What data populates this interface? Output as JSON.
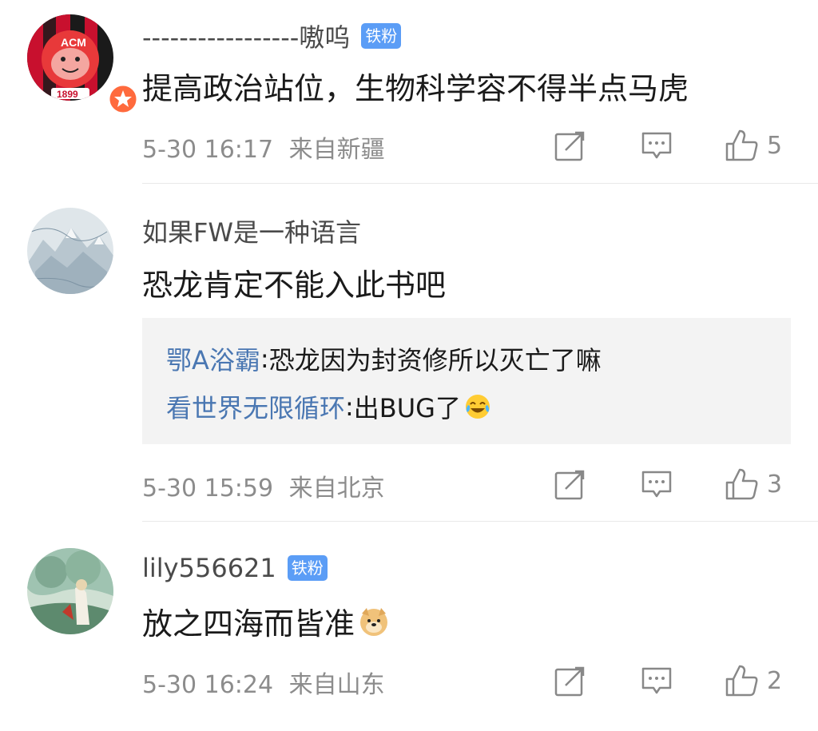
{
  "comments": [
    {
      "username": "-----------------嗷呜",
      "badge": "铁粉",
      "text": "提高政治站位，生物科学容不得半点马虎",
      "time": "5-30 16:17",
      "location": "来自新疆",
      "likes": "5",
      "avatar_icon": "ac-milan-logo-avatar"
    },
    {
      "username": "如果FW是一种语言",
      "text": "恐龙肯定不能入此书吧",
      "replies": [
        {
          "name": "鄂A浴霸",
          "sep": ": ",
          "text": "恐龙因为封资修所以灭亡了嘛"
        },
        {
          "name": "看世界无限循环",
          "sep": ": ",
          "text": "出BUG了",
          "emoji": "laugh-cry-emoji"
        }
      ],
      "time": "5-30 15:59",
      "location": "来自北京",
      "likes": "3",
      "avatar_icon": "mountain-map-avatar"
    },
    {
      "username": "lily556621",
      "badge": "铁粉",
      "text": "放之四海而皆准",
      "text_emoji": "doge-emoji",
      "time": "5-30 16:24",
      "location": "来自山东",
      "likes": "2",
      "avatar_icon": "painting-avatar"
    }
  ],
  "colors": {
    "badge": "#5b9df6",
    "reply_name": "#4a77b2",
    "meta": "#8c8c8c",
    "reply_bg": "#f3f3f3"
  }
}
